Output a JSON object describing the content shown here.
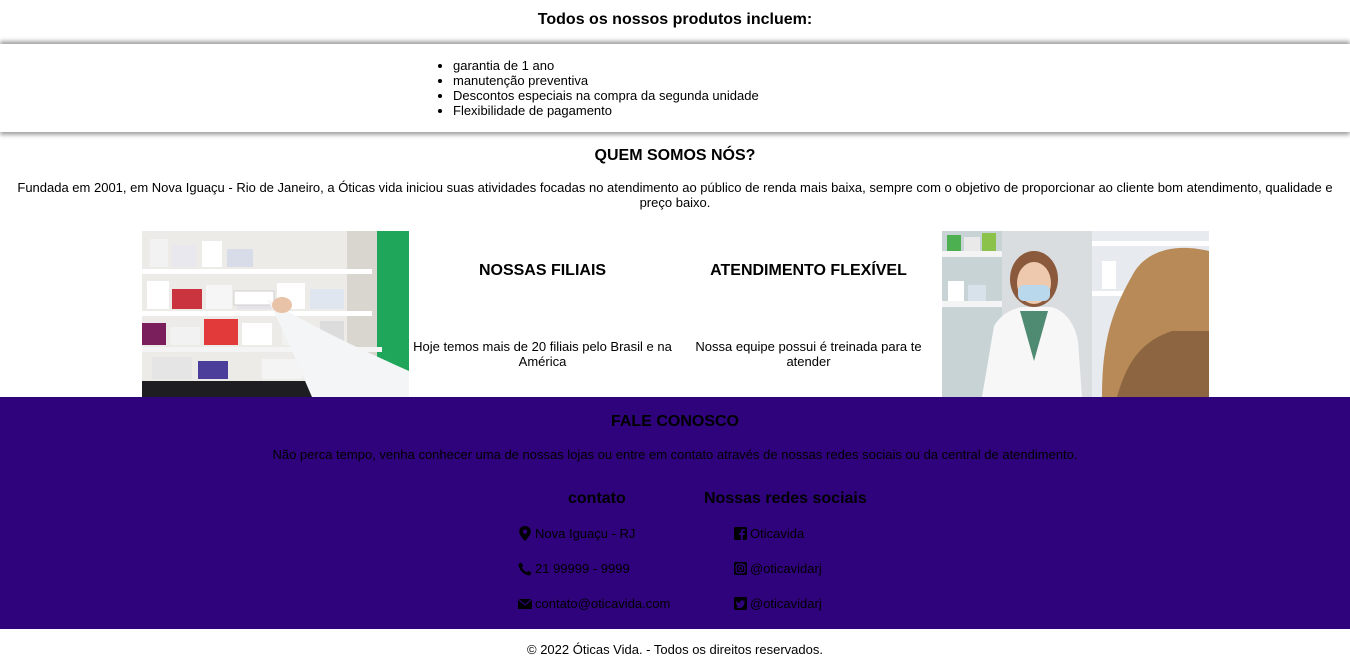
{
  "benefits": {
    "title": "Todos os nossos produtos incluem:",
    "items": [
      "garantia de 1 ano",
      "manutenção preventiva",
      "Descontos especiais na compra da segunda unidade",
      "Flexibilidade de pagamento"
    ]
  },
  "about": {
    "title": "QUEM SOMOS NÓS?",
    "text": "Fundada em 2001, em Nova Iguaçu - Rio de Janeiro, a Óticas vida iniciou suas atividades focadas no atendimento ao público de renda mais baixa, sempre com o objetivo de proporcionar ao cliente bom atendimento, qualidade e preço baixo.",
    "cards": [
      {
        "title": "NOSSAS FILIAIS",
        "text": "Hoje temos mais de 20 filiais pelo Brasil e na América"
      },
      {
        "title": "ATENDIMENTO FLEXÍVEL",
        "text": "Nossa equipe possui é treinada para te atender"
      }
    ]
  },
  "contact": {
    "title": "FALE CONOSCO",
    "text": "Não perca tempo, venha conhecer uma de nossas lojas ou entre em contato através de nossas redes sociais ou da central de atendimento.",
    "contact_title": "contato",
    "location": "Nova Iguaçu - RJ",
    "phone": "21 99999 - 9999",
    "email": "contato@oticavida.com",
    "social_title": "Nossas redes sociais",
    "facebook": "Oticavida",
    "instagram": "@oticavidarj",
    "twitter": "@oticavidarj",
    "background_color": "#2f037b"
  },
  "footer": {
    "copyright": "© 2022 Óticas Vida. - Todos os direitos reservados."
  }
}
